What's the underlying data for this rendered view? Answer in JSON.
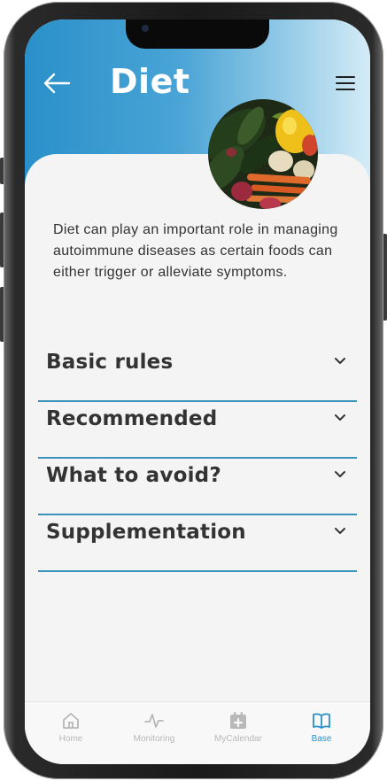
{
  "header": {
    "title": "Diet"
  },
  "intro_text": "Diet can play an important role in managing autoimmune diseases as certain foods can either trigger or alleviate symptoms.",
  "accordion": [
    {
      "label": "Basic rules"
    },
    {
      "label": "Recommended"
    },
    {
      "label": "What to avoid?"
    },
    {
      "label": "Supplementation"
    }
  ],
  "tabbar": {
    "items": [
      {
        "label": "Home",
        "icon": "home-icon"
      },
      {
        "label": "Monitoring",
        "icon": "pulse-icon"
      },
      {
        "label": "MyCalendar",
        "icon": "calendar-plus-icon"
      },
      {
        "label": "Base",
        "icon": "book-open-icon"
      }
    ],
    "active": "Base"
  },
  "colors": {
    "accent": "#2a90c9",
    "divider": "#3a93b8",
    "text": "#333333",
    "inactive": "#b8b8b8"
  }
}
